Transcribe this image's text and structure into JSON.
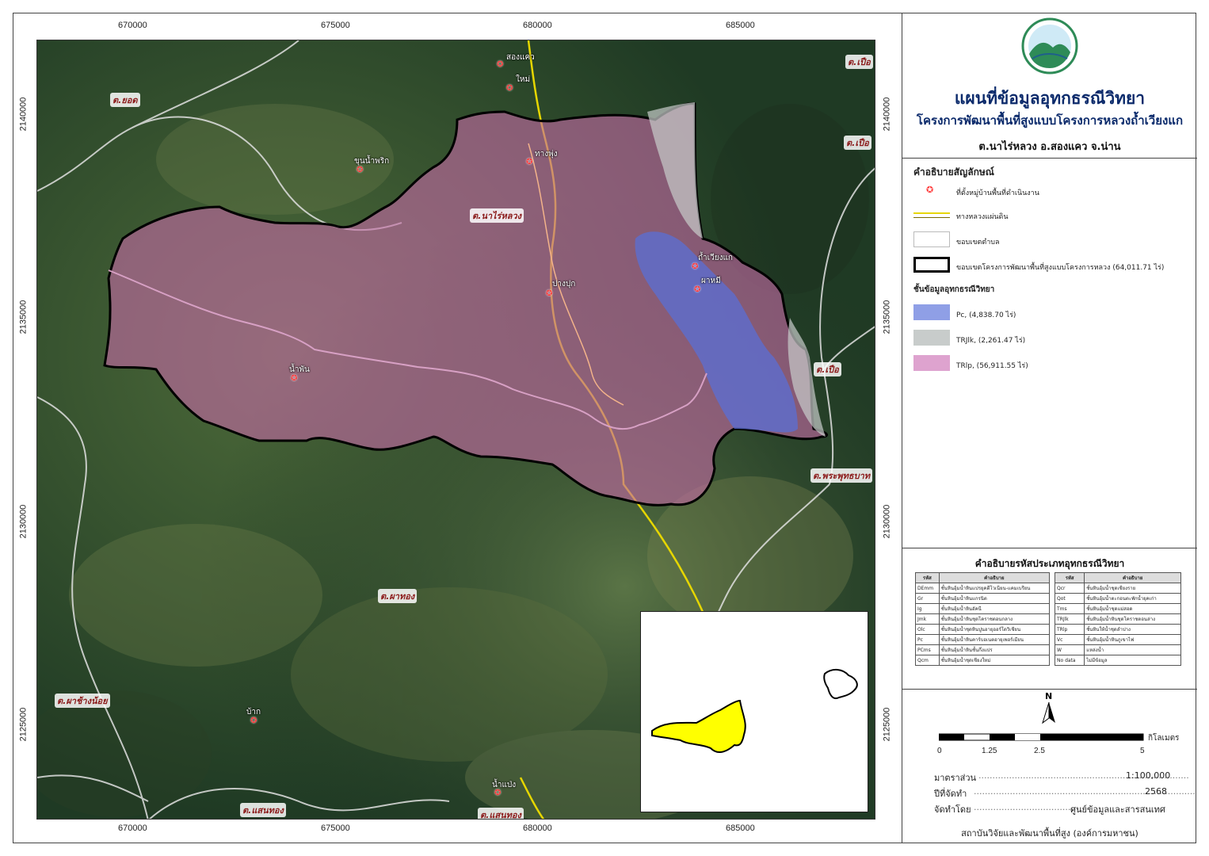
{
  "map": {
    "x_ticks": [
      "670000",
      "675000",
      "680000",
      "685000"
    ],
    "y_ticks": [
      "2140000",
      "2135000",
      "2130000",
      "2125000"
    ],
    "subdistrict_labels": [
      "ต.ยอด",
      "ต.นาไร่หลวง",
      "ต.เปือ",
      "ต.เปือ",
      "ต.เปือ",
      "ต.พระพุทธบาท",
      "ต.ผาทอง",
      "ต.ผาช้างน้อย",
      "ต.แสนทอง",
      "ต.แสนทอง"
    ],
    "villages": [
      "สองแคว",
      "ใหม่",
      "ทางพุ่ง",
      "ขุนน้ำพริก",
      "ถ้ำเวียงแก",
      "ผาหมี",
      "ปางปุก",
      "น้ำพัน",
      "บ้าก",
      "น้ำแป่ง"
    ]
  },
  "title": {
    "main": "แผนที่ข้อมูลอุทกธรณีวิทยา",
    "project": "โครงการพัฒนาพื้นที่สูงแบบโครงการหลวงถ้ำเวียงแก",
    "location": "ต.นาไร่หลวง อ.สองแคว จ.น่าน"
  },
  "legend": {
    "heading": "คำอธิบายสัญลักษณ์",
    "items": [
      {
        "label": "ที่ตั้งหมู่บ้านพื้นที่ดำเนินงาน"
      },
      {
        "label": "ทางหลวงแผ่นดิน"
      },
      {
        "label": "ขอบเขตตำบล"
      },
      {
        "label": "ขอบเขตโครงการพัฒนาพื้นที่สูงแบบโครงการหลวง (64,011.71 ไร่)"
      }
    ],
    "layer_heading": "ชั้นข้อมูลอุทกธรณีวิทยา",
    "layers": [
      {
        "label": "Pc, (4,838.70 ไร่)",
        "color": "#8f9fe6"
      },
      {
        "label": "TRJlk, (2,261.47 ไร่)",
        "color": "#c8cccb"
      },
      {
        "label": "TRlp, (56,911.55 ไร่)",
        "color": "#dea3cf"
      }
    ]
  },
  "codes": {
    "heading": "คำอธิบายรหัสประเภทอุทกธรณีวิทยา",
    "col_code": "รหัส",
    "col_desc": "คำอธิบาย",
    "left": [
      {
        "code": "DEmm",
        "desc": "ชั้นหินอุ้มน้ำหินแปรยุคดีโวเนียน-แคมเบรียน"
      },
      {
        "code": "Gr",
        "desc": "ชั้นหินอุ้มน้ำหินแกรนิต"
      },
      {
        "code": "Ig",
        "desc": "ชั้นหินอุ้มน้ำหินอัคนี"
      },
      {
        "code": "Jmk",
        "desc": "ชั้นหินอุ้มน้ำหินชุดโคราชตอนกลาง"
      },
      {
        "code": "Olc",
        "desc": "ชั้นหินอุ้มน้ำชุดหินปูนอายุออร์โดวิเชียน"
      },
      {
        "code": "Pc",
        "desc": "ชั้นหินอุ้มน้ำหินคาร์บอเนตอายุเพอร์เมียน"
      },
      {
        "code": "PCms",
        "desc": "ชั้นหินอุ้มน้ำหินชั้นกึ่งแปร"
      },
      {
        "code": "Qcm",
        "desc": "ชั้นหินอุ้มน้ำชุดเชียงใหม่"
      }
    ],
    "right": [
      {
        "code": "Qcr",
        "desc": "ชั้นหินอุ้มน้ำชุดเชียงราย"
      },
      {
        "code": "Qot",
        "desc": "ชั้นหินอุ้มน้ำตะกอนตะพักน้ำยุคเก่า"
      },
      {
        "code": "Tms",
        "desc": "ชั้นหินอุ้มน้ำชุดแม่สอด"
      },
      {
        "code": "TRJlk",
        "desc": "ชั้นหินอุ้มน้ำหินชุดโคราชตอนล่าง"
      },
      {
        "code": "TRlp",
        "desc": "ชั้นหินให้น้ำชุดลำปาง"
      },
      {
        "code": "Vc",
        "desc": "ชั้นหินอุ้มน้ำหินภูเขาไฟ"
      },
      {
        "code": "W",
        "desc": "แหล่งน้ำ"
      },
      {
        "code": "No data",
        "desc": "ไม่มีข้อมูล"
      }
    ]
  },
  "scalebar": {
    "north": "N",
    "ticks": [
      "0",
      "1.25",
      "2.5",
      "5"
    ],
    "unit": "กิโลเมตร"
  },
  "info": {
    "scale_label": "มาตราส่วน",
    "scale_value": "1:100,000",
    "year_label": "ปีที่จัดทำ",
    "year_value": "2568",
    "by_label": "จัดทำโดย",
    "by_value": "ศูนย์ข้อมูลและสารสนเทศ",
    "institute": "สถาบันวิจัยและพัฒนาพื้นที่สูง (องค์การมหาชน)"
  },
  "colors": {
    "boundary": "#000000",
    "road": "#e6d600",
    "village": "#ff3b3b"
  }
}
